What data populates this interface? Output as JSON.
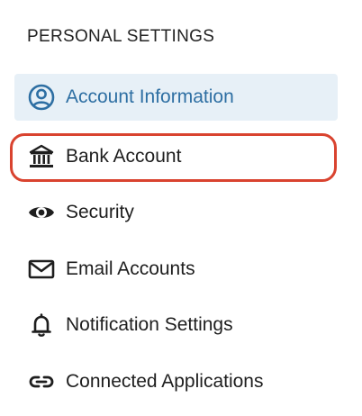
{
  "section": {
    "title": "PERSONAL SETTINGS"
  },
  "items": [
    {
      "label": "Account Information",
      "icon": "account-circle-icon",
      "active": true
    },
    {
      "label": "Bank Account",
      "icon": "bank-icon",
      "active": false,
      "highlighted": true
    },
    {
      "label": "Security",
      "icon": "eye-icon",
      "active": false
    },
    {
      "label": "Email Accounts",
      "icon": "envelope-icon",
      "active": false
    },
    {
      "label": "Notification Settings",
      "icon": "bell-icon",
      "active": false
    },
    {
      "label": "Connected Applications",
      "icon": "link-icon",
      "active": false
    }
  ],
  "colors": {
    "active_background": "#e7f0f7",
    "active_text": "#2e6fa3",
    "highlight_ring": "#d9432f"
  }
}
